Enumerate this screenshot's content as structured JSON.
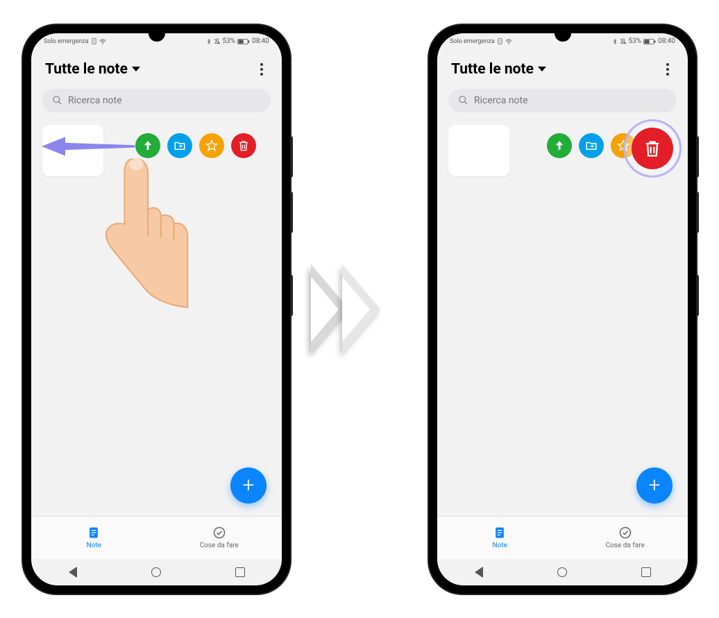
{
  "status": {
    "left_text": "Solo emergenza",
    "battery_text": "53%",
    "time": "08:40"
  },
  "header": {
    "title": "Tutte le note"
  },
  "search": {
    "placeholder": "Ricerca note"
  },
  "actions": {
    "pin": {
      "color": "#22ac38"
    },
    "move": {
      "color": "#00a0e9"
    },
    "favorite": {
      "color": "#f5a100"
    },
    "delete": {
      "color": "#e41e26"
    }
  },
  "fab": {
    "label": "+"
  },
  "tabs": {
    "note": "Note",
    "todo": "Cose da fare"
  },
  "highlight": {
    "target": "delete"
  }
}
